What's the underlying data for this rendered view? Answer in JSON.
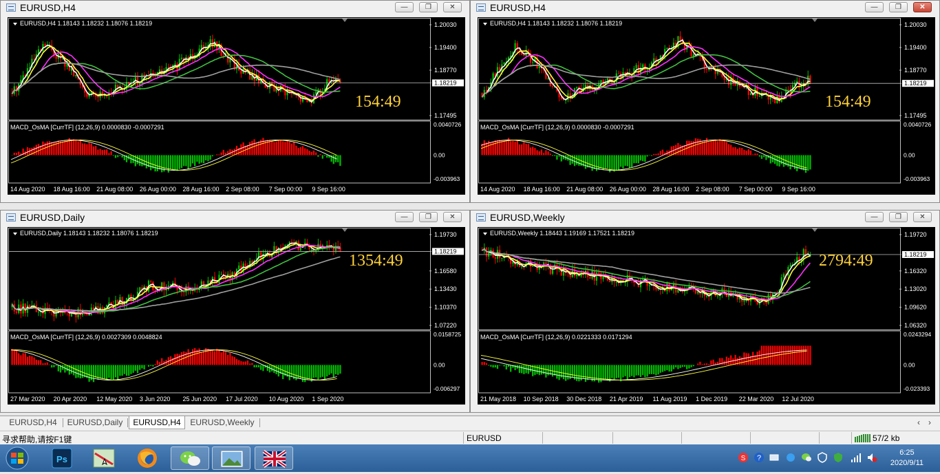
{
  "windows": [
    {
      "title": "EURUSD,H4",
      "info": "EURUSD,H4  1.18143 1.18232 1.18076 1.18219",
      "timer": "154:49",
      "yticks": [
        "1.20030",
        "1.19400",
        "1.18770",
        "1.18219",
        "1.17495"
      ],
      "macd_label": "MACD_OsMA [CurrTF] (12,26,9) 0.0000830 -0.0007291",
      "macd_ticks": [
        "0.0040726",
        "0.00",
        "-0.003963"
      ],
      "xticks": [
        "14 Aug 2020",
        "18 Aug 16:00",
        "21 Aug 08:00",
        "26 Aug 00:00",
        "28 Aug 16:00",
        "2 Sep 08:00",
        "7 Sep 00:00",
        "9 Sep 16:00"
      ]
    },
    {
      "title": "EURUSD,H4",
      "info": "EURUSD,H4  1.18143 1.18232 1.18076 1.18219",
      "timer": "154:49",
      "yticks": [
        "1.20030",
        "1.19400",
        "1.18770",
        "1.18219",
        "1.17495"
      ],
      "macd_label": "MACD_OsMA [CurrTF] (12,26,9) 0.0000830 -0.0007291",
      "macd_ticks": [
        "0.0040726",
        "0.00",
        "-0.003963"
      ],
      "xticks": [
        "14 Aug 2020",
        "18 Aug 16:00",
        "21 Aug 08:00",
        "26 Aug 00:00",
        "28 Aug 16:00",
        "2 Sep 08:00",
        "7 Sep 00:00",
        "9 Sep 16:00"
      ]
    },
    {
      "title": "EURUSD,Daily",
      "info": "EURUSD,Daily  1.18143 1.18232 1.18076 1.18219",
      "timer": "1354:49",
      "yticks": [
        "1.19730",
        "1.18219",
        "1.16580",
        "1.13430",
        "1.10370",
        "1.07220"
      ],
      "macd_label": "MACD_OsMA [CurrTF] (12,26,9) 0.0027309 0.0048824",
      "macd_ticks": [
        "0.0158725",
        "0.00",
        "-0.006297"
      ],
      "xticks": [
        "27 Mar 2020",
        "20 Apr 2020",
        "12 May 2020",
        "3 Jun 2020",
        "25 Jun 2020",
        "17 Jul 2020",
        "10 Aug 2020",
        "1 Sep 2020"
      ]
    },
    {
      "title": "EURUSD,Weekly",
      "info": "EURUSD,Weekly  1.18443 1.19169 1.17521 1.18219",
      "timer": "2794:49",
      "yticks": [
        "1.19720",
        "1.18219",
        "1.16320",
        "1.13020",
        "1.09620",
        "1.06320"
      ],
      "macd_label": "MACD_OsMA [CurrTF] (12,26,9) 0.0221333 0.0171294",
      "macd_ticks": [
        "0.0243294",
        "0.00",
        "-0.023393"
      ],
      "xticks": [
        "21 May 2018",
        "10 Sep 2018",
        "30 Dec 2018",
        "21 Apr 2019",
        "11 Aug 2019",
        "1 Dec 2019",
        "22 Mar 2020",
        "12 Jul 2020"
      ]
    }
  ],
  "tabs": [
    "EURUSD,H4",
    "EURUSD,Daily",
    "EURUSD,H4",
    "EURUSD,Weekly"
  ],
  "active_tab": 2,
  "status": {
    "help": "寻求帮助,请按F1键",
    "symbol": "EURUSD",
    "traffic": "57/2 kb"
  },
  "taskbar": {
    "time": "6:25",
    "date": "2020/9/11",
    "apps": [
      "windows-start",
      "photoshop",
      "map-app",
      "firefox",
      "wechat",
      "photo-viewer",
      "uk-flag-app"
    ]
  },
  "colors": {
    "bull": "#00c000",
    "bear": "#ff0000",
    "timer": "#ffd23a",
    "ma_white": "#ffffff",
    "ma_yellow": "#ffff40",
    "ma_magenta": "#ff30ff",
    "ma_green": "#40c040",
    "ma_gray": "#a0a0a0"
  }
}
